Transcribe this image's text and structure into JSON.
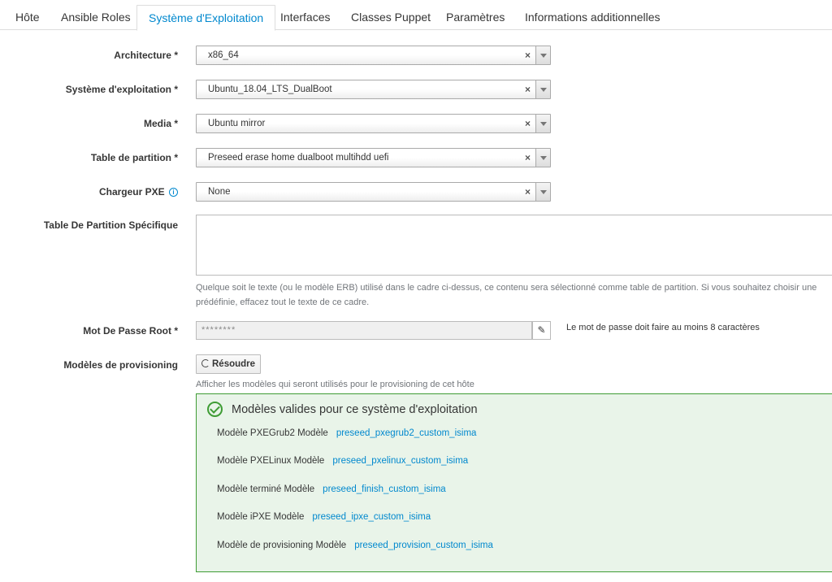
{
  "tabs": [
    {
      "label": "Hôte"
    },
    {
      "label": "Ansible Roles"
    },
    {
      "label": "Système d'Exploitation"
    },
    {
      "label": "Interfaces"
    },
    {
      "label": "Classes Puppet"
    },
    {
      "label": "Paramètres"
    },
    {
      "label": "Informations additionnelles"
    }
  ],
  "form": {
    "architecture": {
      "label": "Architecture *",
      "value": "x86_64"
    },
    "os": {
      "label": "Système d'exploitation *",
      "value": "Ubuntu_18.04_LTS_DualBoot"
    },
    "media": {
      "label": "Media *",
      "value": "Ubuntu mirror"
    },
    "ptable": {
      "label": "Table de partition *",
      "value": "Preseed erase home dualboot multihdd uefi"
    },
    "pxe_loader": {
      "label": "Chargeur PXE",
      "value": "None",
      "info_glyph": "i"
    },
    "custom_ptable": {
      "label": "Table De Partition Spécifique",
      "help_line1": "Quelque soit le texte (ou le modèle ERB) utilisé dans le cadre ci-dessus, ce contenu sera sélectionné comme table de partition. Si vous souhaitez choisir une",
      "help_line2": "prédéfinie, effacez tout le texte de ce cadre."
    },
    "root_pass": {
      "label": "Mot De Passe Root *",
      "value": "********",
      "note": "Le mot de passe doit faire au moins 8 caractères"
    },
    "provisioning": {
      "label": "Modèles de provisioning",
      "button": "Résoudre",
      "help": "Afficher les modèles qui seront utilisés pour le provisioning de cet hôte"
    },
    "clear_glyph": "×",
    "edit_glyph": "✎"
  },
  "templates_panel": {
    "title": "Modèles valides pour ce système d'exploitation",
    "status_color": "#3f9c35",
    "items": [
      {
        "kind": "Modèle PXEGrub2 Modèle",
        "name": "preseed_pxegrub2_custom_isima"
      },
      {
        "kind": "Modèle PXELinux Modèle",
        "name": "preseed_pxelinux_custom_isima"
      },
      {
        "kind": "Modèle terminé Modèle",
        "name": "preseed_finish_custom_isima"
      },
      {
        "kind": "Modèle iPXE Modèle",
        "name": "preseed_ipxe_custom_isima"
      },
      {
        "kind": "Modèle de provisioning Modèle",
        "name": "preseed_provision_custom_isima"
      }
    ]
  },
  "colors": {
    "accent": "#0088ce",
    "success": "#3f9c35"
  }
}
